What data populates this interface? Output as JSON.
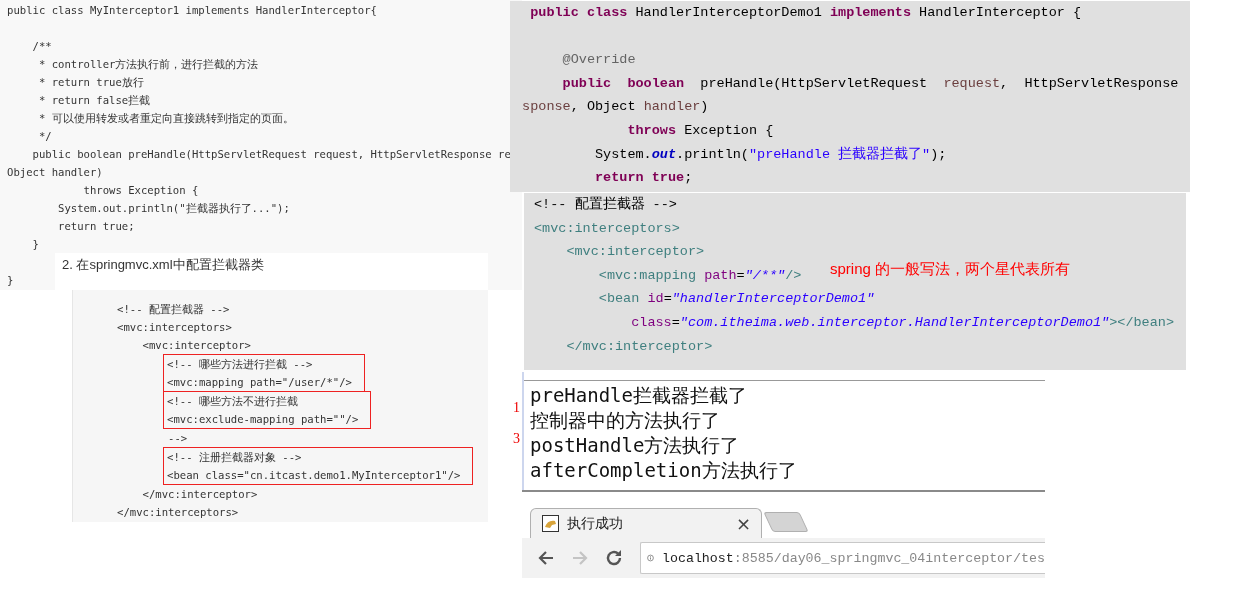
{
  "article_code": {
    "blocks": [
      [
        "public class MyInterceptor1 implements HandlerInterceptor{"
      ],
      [
        "    /**",
        "     * controller方法执行前，进行拦截的方法",
        "     * return true放行",
        "     * return false拦截",
        "     * 可以使用转发或者重定向直接跳转到指定的页面。",
        "     */",
        "    public boolean preHandle(HttpServletRequest request, HttpServletResponse re",
        "Object handler)",
        "            throws Exception {",
        "        System.out.println(\"拦截器执行了...\");",
        "        return true;",
        "    }"
      ],
      [
        "}"
      ]
    ]
  },
  "section_heading": "2. 在springmvc.xml中配置拦截器类",
  "xml_code": {
    "groups": [
      {
        "kind": "block",
        "highlighted": false,
        "lines": [
          "<!-- 配置拦截器 -->",
          "<mvc:interceptors>",
          "    <mvc:interceptor>"
        ]
      },
      {
        "kind": "inner",
        "highlighted": true,
        "lines": [
          "<!-- 哪些方法进行拦截 -->",
          "<mvc:mapping path=\"/user/*\"/>"
        ]
      },
      {
        "kind": "inner",
        "highlighted": true,
        "lines": [
          "<!-- 哪些方法不进行拦截",
          "<mvc:exclude-mapping path=\"\"/>"
        ]
      },
      {
        "kind": "block",
        "highlighted": false,
        "lines": [
          "        -->"
        ]
      },
      {
        "kind": "inner",
        "highlighted": true,
        "lines": [
          "<!-- 注册拦截器对象 -->",
          "<bean class=\"cn.itcast.demo1.MyInterceptor1\"/>"
        ]
      },
      {
        "kind": "block",
        "highlighted": false,
        "lines": [
          "    </mvc:interceptor>",
          "</mvc:interceptors>"
        ]
      }
    ]
  },
  "ide_java": {
    "blocks": [
      [
        [
          {
            "kind": "keyword",
            "text": "  public class"
          },
          {
            "kind": "plain",
            "text": " HandlerInterceptorDemo1 "
          },
          {
            "kind": "keyword",
            "text": "implements"
          },
          {
            "kind": "plain",
            "text": " HandlerInterceptor {"
          }
        ]
      ],
      [
        [
          {
            "kind": "annotation",
            "text": "      @Override"
          }
        ],
        [
          {
            "kind": "keyword",
            "text": "      public  boolean"
          },
          {
            "kind": "plain",
            "text": "  preHandle(HttpServletRequest  "
          },
          {
            "kind": "param",
            "text": "request"
          },
          {
            "kind": "plain",
            "text": ",  HttpServletResponse"
          }
        ],
        [
          {
            "kind": "param",
            "text": " sponse"
          },
          {
            "kind": "plain",
            "text": ", Object "
          },
          {
            "kind": "param",
            "text": "handler"
          },
          {
            "kind": "plain",
            "text": ")"
          }
        ],
        [
          {
            "kind": "keyword",
            "text": "              throws"
          },
          {
            "kind": "plain",
            "text": " Exception {"
          }
        ],
        [
          {
            "kind": "plain",
            "text": "          System."
          },
          {
            "kind": "field",
            "text": "out"
          },
          {
            "kind": "plain",
            "text": ".println("
          },
          {
            "kind": "string",
            "text": "\"preHandle 拦截器拦截了\""
          },
          {
            "kind": "plain",
            "text": ");"
          }
        ],
        [
          {
            "kind": "keyword",
            "text": "          return true"
          },
          {
            "kind": "plain",
            "text": ";"
          }
        ]
      ]
    ]
  },
  "ide_xml": {
    "blocks": [
      [
        [
          {
            "kind": "comment",
            "text": "<!-- 配置拦截器 -->"
          }
        ],
        [
          {
            "kind": "tag",
            "text": "<mvc:interceptors>"
          }
        ],
        [
          {
            "kind": "tag",
            "text": "    <mvc:interceptor>"
          }
        ],
        [
          {
            "kind": "tag",
            "text": "        <mvc:mapping "
          },
          {
            "kind": "attr",
            "text": "path"
          },
          {
            "kind": "plain",
            "text": "="
          },
          {
            "kind": "string",
            "text": "\"/**\""
          },
          {
            "kind": "tag",
            "text": "/>"
          }
        ],
        [
          {
            "kind": "tag",
            "text": "        <bean "
          },
          {
            "kind": "attr",
            "text": "id"
          },
          {
            "kind": "plain",
            "text": "="
          },
          {
            "kind": "string",
            "text": "\"handlerInterceptorDemo1\""
          }
        ],
        [
          {
            "kind": "attr",
            "text": "            class"
          },
          {
            "kind": "plain",
            "text": "="
          },
          {
            "kind": "string",
            "text": "\"com.itheima.web.interceptor.HandlerInterceptorDemo1\""
          },
          {
            "kind": "tag",
            "text": "></bean>"
          }
        ],
        [
          {
            "kind": "tag",
            "text": "    </mvc:interceptor>"
          }
        ]
      ]
    ],
    "note": "spring 的一般写法，两个星代表所有"
  },
  "console": {
    "lines": [
      {
        "text": "preHandle拦截器拦截了",
        "mark": "1"
      },
      {
        "text": "控制器中的方法执行了"
      },
      {
        "text": "postHandle方法执行了",
        "mark": "3"
      },
      {
        "text": "afterCompletion方法执行了"
      }
    ]
  },
  "browser": {
    "tab": {
      "title": "执行成功",
      "close": "×"
    },
    "nav": [
      {
        "kind": "back",
        "disabled": false
      },
      {
        "kind": "forward",
        "disabled": true
      },
      {
        "kind": "reload",
        "disabled": false
      }
    ],
    "url": {
      "host": "localhost",
      "path": ":8585/day06_springmvc_04interceptor/tes"
    }
  }
}
